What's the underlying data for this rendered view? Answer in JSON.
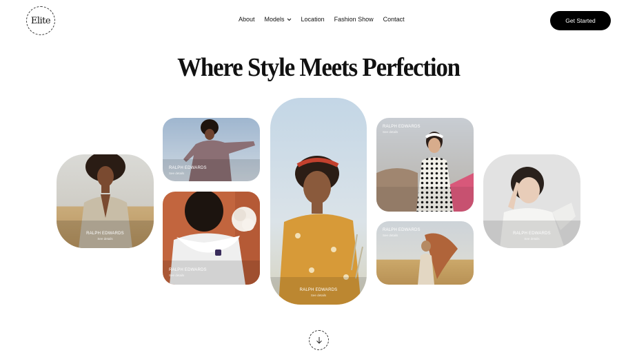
{
  "brand": {
    "logo_text": "Elite"
  },
  "nav": {
    "items": [
      {
        "label": "About"
      },
      {
        "label": "Models",
        "has_dropdown": true
      },
      {
        "label": "Location"
      },
      {
        "label": "Fashion Show"
      },
      {
        "label": "Contact"
      }
    ],
    "cta_label": "Get Started"
  },
  "hero": {
    "title": "Where Style Meets Perfection"
  },
  "cards": [
    {
      "name": "RALPH EDWARDS",
      "link": "See details"
    },
    {
      "name": "RALPH EDWARDS",
      "link": "See details"
    },
    {
      "name": "RALPH EDWARDS",
      "link": "See details"
    },
    {
      "name": "RALPH EDWARDS",
      "link": "See details"
    },
    {
      "name": "RALPH EDWARDS",
      "link": "See details"
    },
    {
      "name": "RALPH EDWARDS",
      "link": "See details"
    },
    {
      "name": "RALPH EDWARDS",
      "link": "See details"
    }
  ],
  "colors": {
    "background": "#ffffff",
    "cta_background": "#000000",
    "text": "#111111"
  },
  "icons": {
    "scroll": "arrow-down-icon",
    "models_dropdown": "chevron-down-icon"
  }
}
